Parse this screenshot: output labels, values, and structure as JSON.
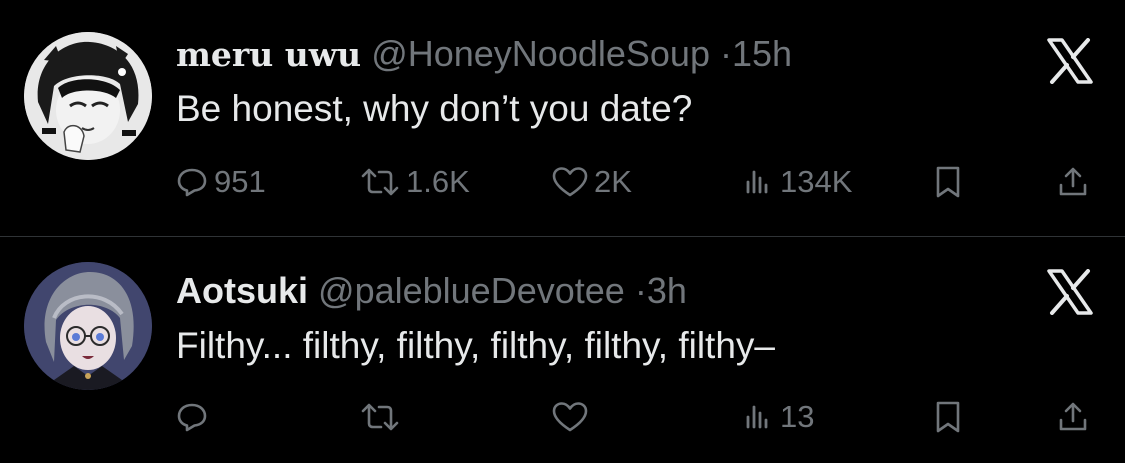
{
  "theme": {
    "background": "#000000",
    "text_primary": "#e7e9ea",
    "text_secondary": "#71767b",
    "divider": "#2f3336"
  },
  "tweets": [
    {
      "display_name": "meru uwu",
      "handle": "@HoneyNoodleSoup",
      "separator": "·",
      "time": "15h",
      "text": "Be honest, why don’t you date?",
      "avatar_icon": "anime-girl-monochrome-avatar",
      "platform_icon": "x-logo-icon",
      "stats": {
        "replies": "951",
        "retweets": "1.6K",
        "likes": "2K",
        "views": "134K"
      }
    },
    {
      "display_name": "Aotsuki",
      "handle": "@paleblueDevotee",
      "separator": "·",
      "time": "3h",
      "text": "Filthy... filthy, filthy, filthy, filthy, filthy–",
      "avatar_icon": "anime-character-with-glasses-avatar",
      "platform_icon": "x-logo-icon",
      "stats": {
        "replies": "",
        "retweets": "",
        "likes": "",
        "views": "13"
      }
    }
  ]
}
